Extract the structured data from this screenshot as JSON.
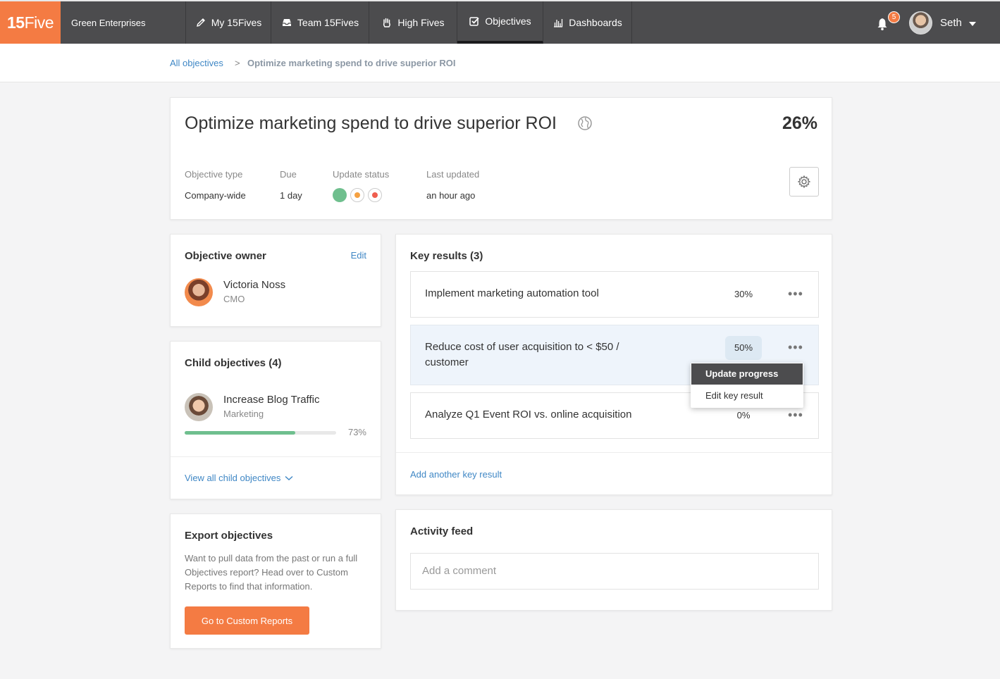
{
  "nav": {
    "logo_bold": "15",
    "logo_light": "Five",
    "company": "Green Enterprises",
    "items": [
      {
        "label": "My 15Fives"
      },
      {
        "label": "Team 15Fives"
      },
      {
        "label": "High Fives"
      },
      {
        "label": "Objectives"
      },
      {
        "label": "Dashboards"
      }
    ],
    "notification_count": "5",
    "user": "Seth"
  },
  "breadcrumb": {
    "root": "All objectives",
    "sep": ">",
    "current": "Optimize marketing spend to drive superior ROI"
  },
  "objective": {
    "title": "Optimize marketing spend to drive superior ROI",
    "percent": "26%",
    "type_label": "Objective type",
    "type_value": "Company-wide",
    "due_label": "Due",
    "due_value": "1 day",
    "status_label": "Update status",
    "status_colors": [
      "#6fbf8e",
      "#f5a142",
      "#ef5e4f"
    ],
    "updated_label": "Last updated",
    "updated_value": "an hour ago"
  },
  "owner": {
    "heading": "Objective owner",
    "edit": "Edit",
    "name": "Victoria Noss",
    "role": "CMO"
  },
  "child": {
    "heading": "Child objectives (4)",
    "name": "Increase Blog Traffic",
    "team": "Marketing",
    "percent": "73%",
    "progress": 0.73,
    "view_all": "View all child objectives"
  },
  "export": {
    "heading": "Export objectives",
    "text_1": "Want to pull data from the past or run a full",
    "text_2": "Objectives report? Head over to Custom",
    "text_3": "Reports to find that information.",
    "button": "Go to Custom Reports"
  },
  "key_results": {
    "heading": "Key results (3)",
    "items": [
      {
        "title": "Implement marketing automation tool",
        "percent": "30%"
      },
      {
        "title_1": "Reduce cost of user acquisition to < $50 /",
        "title_2": "customer",
        "percent": "50%"
      },
      {
        "title": "Analyze Q1 Event ROI vs. online acquisition",
        "percent": "0%"
      }
    ],
    "more": "•••",
    "add": "Add another key result"
  },
  "menu": {
    "update": "Update progress",
    "edit": "Edit key result"
  },
  "activity": {
    "heading": "Activity feed",
    "placeholder": "Add a comment"
  },
  "colors": {
    "brand": "#f47b43",
    "nav": "#4c4c4e",
    "link": "#3f87c5",
    "progress": "#6fbf8e"
  }
}
